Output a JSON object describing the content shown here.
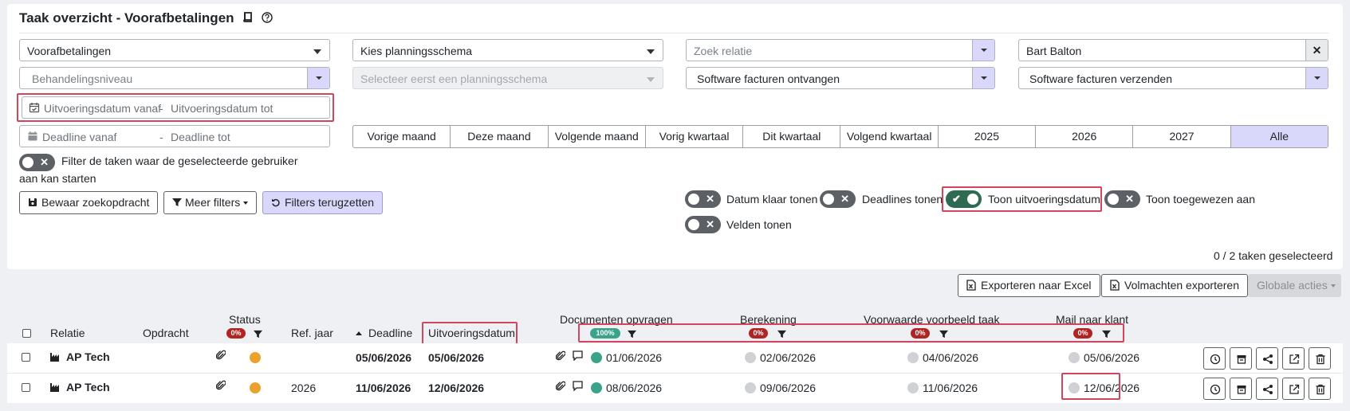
{
  "header": {
    "title": "Taak overzicht - Voorafbetalingen"
  },
  "filters": {
    "type_select": "Voorafbetalingen",
    "schema_select": "Kies planningsschema",
    "relation_placeholder": "Zoek relatie",
    "user_value": "Bart Balton",
    "level_placeholder": "Behandelingsniveau",
    "schema_disabled_placeholder": "Selecteer eerst een planningsschema",
    "software_received": "Software facturen ontvangen",
    "software_send": "Software facturen verzenden",
    "exec_from": "Uitvoeringsdatum vanaf",
    "exec_to": "Uitvoeringsdatum tot",
    "deadline_from": "Deadline vanaf",
    "deadline_to": "Deadline tot",
    "range_sep": "-",
    "periods": [
      "Vorige maand",
      "Deze maand",
      "Volgende maand",
      "Vorig kwartaal",
      "Dit kwartaal",
      "Volgend kwartaal",
      "2025",
      "2026",
      "2027",
      "Alle"
    ],
    "start_filter_label": "Filter de taken waar de geselecteerde gebruiker aan kan starten"
  },
  "buttons": {
    "save_search": "Bewaar zoekopdracht",
    "more_filters": "Meer filters",
    "reset_filters": "Filters terugzetten",
    "export_excel": "Exporteren naar Excel",
    "export_mandates": "Volmachten exporteren",
    "global_actions": "Globale acties"
  },
  "toggles": {
    "date_done": "Datum klaar tonen",
    "deadlines": "Deadlines tonen",
    "exec_date": "Toon uitvoeringsdatum",
    "assigned": "Toon toegewezen aan",
    "fields": "Velden tonen"
  },
  "selection_count": "0 / 2 taken geselecteerd",
  "table": {
    "columns": {
      "relation": "Relatie",
      "assignment": "Opdracht",
      "status": "Status",
      "ref_year": "Ref. jaar",
      "deadline": "Deadline",
      "exec_date": "Uitvoeringsdatum",
      "documents": "Documenten opvragen",
      "calculation": "Berekening",
      "example": "Voorwaarde voorbeeld taak",
      "mail": "Mail naar klant"
    },
    "badges": {
      "status": "0%",
      "documents": "100%",
      "calculation": "0%",
      "example": "0%",
      "mail": "0%"
    },
    "rows": [
      {
        "relation": "AP Tech",
        "ref_year": "",
        "deadline": "05/06/2026",
        "exec_date": "05/06/2026",
        "documents": "01/06/2026",
        "calculation": "02/06/2026",
        "example": "04/06/2026",
        "mail": "05/06/2026"
      },
      {
        "relation": "AP Tech",
        "ref_year": "2026",
        "deadline": "11/06/2026",
        "exec_date": "12/06/2026",
        "documents": "08/06/2026",
        "calculation": "09/06/2026",
        "example": "11/06/2026",
        "mail": "12/06/2026"
      }
    ]
  },
  "colors": {
    "accent_purple": "#d9d8fa",
    "highlight_red": "#d3445f",
    "success_green": "#3aa389",
    "toggle_on": "#2e6b51"
  }
}
